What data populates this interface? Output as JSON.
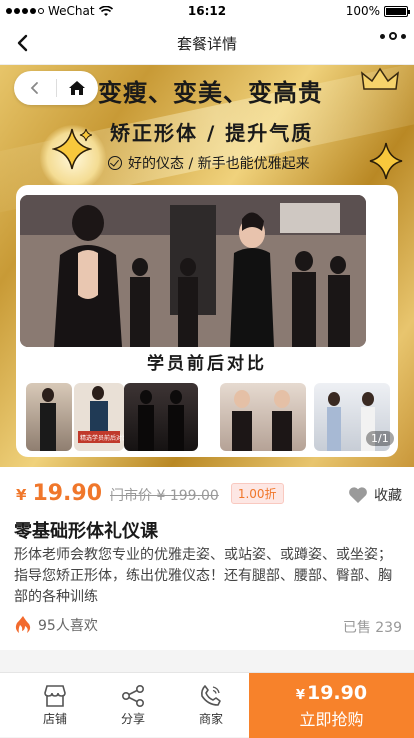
{
  "status_bar": {
    "carrier": "WeChat",
    "time": "16:12",
    "battery": "100%"
  },
  "nav": {
    "title": "套餐详情"
  },
  "banner": {
    "headline": "变瘦、变美、变高贵",
    "subline": "矫正形体 / 提升气质",
    "tagline": "好的仪态 / 新手也能优雅起来",
    "compare_label": "学员前后对比",
    "thumb_caption": "精选学员前后对比",
    "thumb_page": "1/1"
  },
  "product": {
    "currency": "¥",
    "price": "19.90",
    "original_price": "门市价 ¥ 199.00",
    "discount": "1.00折",
    "favorite_label": "收藏",
    "title": "零基础形体礼仪课",
    "description": "形体老师会教您专业的优雅走姿、或站姿、或蹲姿、或坐姿；指导您矫正形体，练出优雅仪态！还有腿部、腰部、臀部、胸部的各种训练",
    "likes": "95人喜欢",
    "sold": "已售 239"
  },
  "bottom_bar": {
    "tabs": [
      {
        "label": "店铺",
        "icon": "store-icon"
      },
      {
        "label": "分享",
        "icon": "share-icon"
      },
      {
        "label": "商家",
        "icon": "phone-icon"
      }
    ],
    "buy_currency": "¥",
    "buy_price": "19.90",
    "buy_label": "立即抢购"
  },
  "colors": {
    "accent": "#f7822b",
    "price": "#f0772b",
    "gold": "#d4a94a"
  }
}
